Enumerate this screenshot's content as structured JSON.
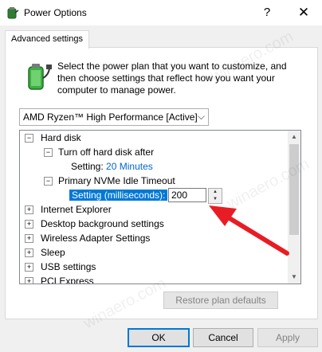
{
  "window": {
    "title": "Power Options",
    "help_glyph": "?",
    "close_glyph": "✕"
  },
  "tab": {
    "label": "Advanced settings"
  },
  "intro": {
    "text": "Select the power plan that you want to customize, and then choose settings that reflect how you want your computer to manage power."
  },
  "plan_select": {
    "value": "AMD Ryzen™ High Performance [Active]"
  },
  "tree": {
    "items": [
      {
        "label": "Hard disk",
        "expander": "⊟"
      },
      {
        "label": "Turn off hard disk after",
        "expander": "⊟"
      },
      {
        "label": "Setting:",
        "value": "20 Minutes"
      },
      {
        "label": "Primary NVMe Idle Timeout",
        "expander": "⊟"
      },
      {
        "label": "Setting (milliseconds):",
        "value": "200"
      },
      {
        "label": "Internet Explorer",
        "expander": "⊞"
      },
      {
        "label": "Desktop background settings",
        "expander": "⊞"
      },
      {
        "label": "Wireless Adapter Settings",
        "expander": "⊞"
      },
      {
        "label": "Sleep",
        "expander": "⊞"
      },
      {
        "label": "USB settings",
        "expander": "⊞"
      },
      {
        "label": "PCI Express",
        "expander": "⊞"
      }
    ]
  },
  "buttons": {
    "restore": "Restore plan defaults",
    "ok": "OK",
    "cancel": "Cancel",
    "apply": "Apply"
  },
  "watermark": "winaero.com",
  "colors": {
    "selection": "#0078d7",
    "link": "#0066cc",
    "annotation_arrow": "#e81c24"
  },
  "icons": {
    "app": "power-options-icon",
    "plan": "battery-plug-icon",
    "expand": "plus-box-icon",
    "collapse": "minus-box-icon"
  }
}
